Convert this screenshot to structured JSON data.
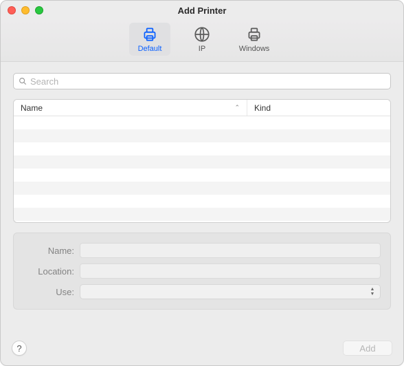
{
  "window": {
    "title": "Add Printer"
  },
  "toolbar": {
    "items": [
      {
        "label": "Default",
        "icon": "printer-icon",
        "selected": true
      },
      {
        "label": "IP",
        "icon": "globe-icon",
        "selected": false
      },
      {
        "label": "Windows",
        "icon": "printer-alt-icon",
        "selected": false
      }
    ]
  },
  "search": {
    "placeholder": "Search",
    "value": ""
  },
  "list": {
    "columns": [
      {
        "label": "Name",
        "sort": "asc"
      },
      {
        "label": "Kind"
      }
    ],
    "rows": []
  },
  "form": {
    "name_label": "Name:",
    "name_value": "",
    "location_label": "Location:",
    "location_value": "",
    "use_label": "Use:",
    "use_value": ""
  },
  "footer": {
    "help_label": "?",
    "add_label": "Add",
    "add_enabled": false
  }
}
